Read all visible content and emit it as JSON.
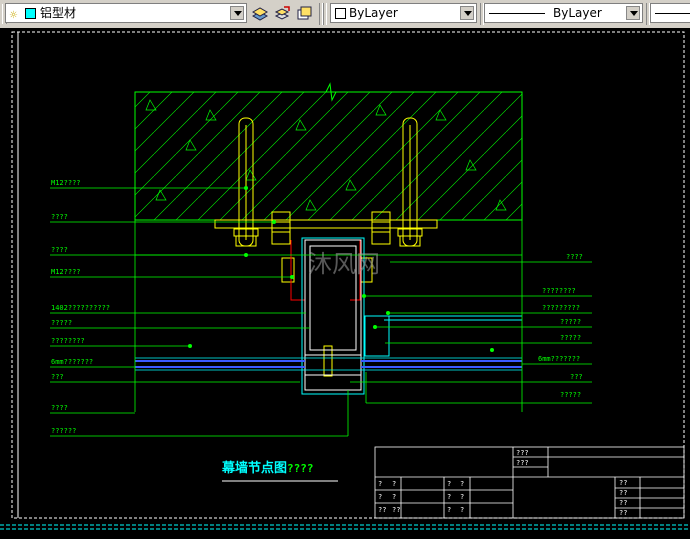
{
  "toolbar": {
    "layer_name": "铝型材",
    "color_value": "ByLayer",
    "linetype_value": "ByLayer",
    "icons": [
      "layer-manager-icon",
      "layer-previous-icon",
      "layer-state-icon"
    ]
  },
  "drawing": {
    "left_labels": [
      "M12????",
      "????",
      "????",
      "M12????",
      "1402??????????",
      "?????",
      "????????",
      "6mm???????",
      "???",
      "????",
      "??????"
    ],
    "right_labels": [
      "????",
      "????????",
      "?????????",
      "?????",
      "?????",
      "6mm???????",
      "???",
      "?????"
    ],
    "title_cn": "幕墙节点图",
    "title_suffix": "????",
    "watermark": "沐风网",
    "titleblock_cells": [
      "???",
      "???",
      "?",
      "?",
      "?",
      "?",
      "??",
      "??",
      "?",
      "?",
      "?",
      "?",
      "?",
      "?",
      "??",
      "??",
      "??",
      "??",
      "???"
    ]
  },
  "colors": {
    "green": "#00ff00",
    "yellow": "#ffff00",
    "cyan": "#00ffff",
    "white": "#ffffff",
    "blue": "#3b5bff",
    "red": "#ff0000"
  }
}
